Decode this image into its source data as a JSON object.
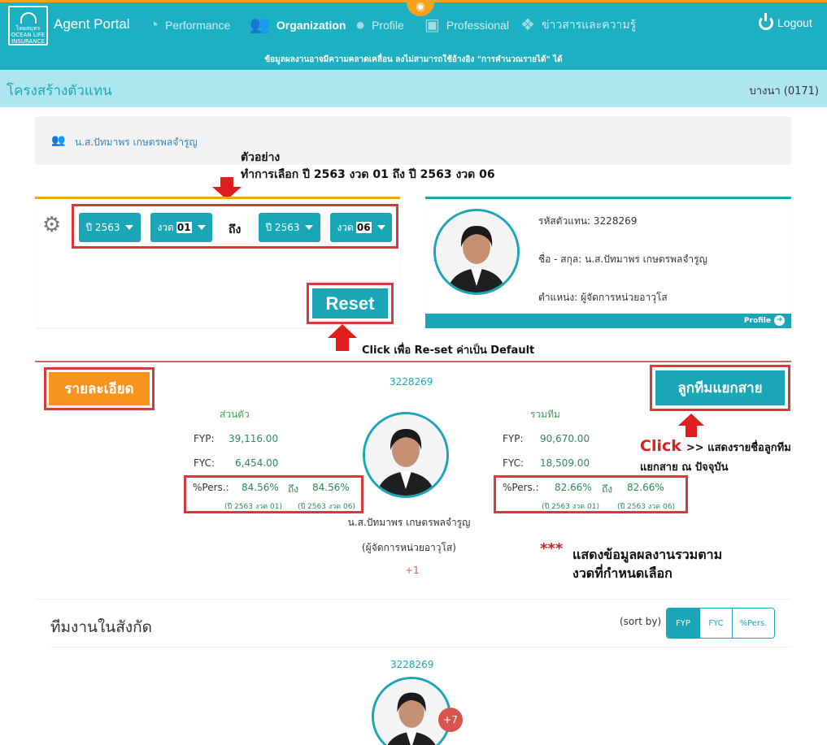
{
  "nav": {
    "logo_text": "ไทยสมุทร OCEAN LIFE INSURANCE",
    "brand": "Agent Portal",
    "items": [
      {
        "label": "Performance",
        "icon": "gauge-icon"
      },
      {
        "label": "Organization",
        "icon": "users-icon"
      },
      {
        "label": "Profile",
        "icon": "user-icon"
      },
      {
        "label": "Professional",
        "icon": "briefcase-icon"
      },
      {
        "label": "ข่าวสารและความรู้",
        "icon": "handshake-icon"
      }
    ],
    "logout": "Logout",
    "notice": "ข้อมูลผลงานอาจมีความคลาดเคลื่อน ลงไม่สามารถใช้อ้างอิง \"การคำนวณรายได้\" ได้"
  },
  "header": {
    "title": "โครงสร้างตัวแทน",
    "branch": "บางนา (0171)"
  },
  "breadcrumb": {
    "text": "น.ส.ปัทมาพร เกษตรพลจำรูญ"
  },
  "annotations": {
    "example_line1": "ตัวอย่าง",
    "example_line2": "ทำการเลือก ปี 2563 งวด 01 ถึง ปี 2563 งวด 06",
    "reset_note": "Click เพื่อ Re-set ค่าเป็น Default",
    "click_word": "Click",
    "team_note_line1": ">> แสดงรายชื่อลูกทีม",
    "team_note_line2": "แยกสาย ณ ปัจจุบัน",
    "stars": "***",
    "summary_line1": "แสดงข้อมูลผลงานรวมตาม",
    "summary_line2": "งวดที่กำหนดเลือก"
  },
  "filter": {
    "from_year": "ปี 2563",
    "from_period_label": "งวด",
    "from_period": "01",
    "to_label": "ถึง",
    "to_year": "ปี 2563",
    "to_period_label": "งวด",
    "to_period": "06",
    "reset": "Reset"
  },
  "profile": {
    "code_line": "รหัสตัวแทน: 3228269",
    "name_line": "ชื่อ - สกุล: น.ส.ปัทมาพร เกษตรพลจำรูญ",
    "position_line": "ตำแหน่ง: ผู้จัดการหน่วยอาวุโส",
    "link": "Profile"
  },
  "summary": {
    "detail_button": "รายละเอียด",
    "team_button": "ลูกทีมแยกสาย",
    "agent_code": "3228269",
    "personal": {
      "heading": "ส่วนตัว",
      "fyp_label": "FYP:",
      "fyp": "39,116.00",
      "fyc_label": "FYC:",
      "fyc": "6,454.00",
      "pers_label": "%Pers.:",
      "pers_from": "84.56%",
      "pers_to_label": "ถึง",
      "pers_to": "84.56%",
      "period_from": "(ปี 2563 งวด 01)",
      "period_to": "(ปี 2563 งวด 06)"
    },
    "team": {
      "heading": "รวมทีม",
      "fyp_label": "FYP:",
      "fyp": "90,670.00",
      "fyc_label": "FYC:",
      "fyc": "18,509.00",
      "pers_label": "%Pers.:",
      "pers_from": "82.66%",
      "pers_to_label": "ถึง",
      "pers_to": "82.66%",
      "period_from": "(ปี 2563 งวด 01)",
      "period_to": "(ปี 2563 งวด 06)"
    },
    "name": "น.ส.ปัทมาพร เกษตรพลจำรูญ",
    "role": "(ผู้จัดการหน่วยอาวุโส)",
    "plus": "+1"
  },
  "team_section": {
    "title": "ทีมงานในสังกัด",
    "sort_label": "(sort by)",
    "sort_options": [
      "FYP",
      "FYC",
      "%Pers."
    ],
    "member_code": "3228269",
    "member_badge": "+7"
  },
  "colors": {
    "primary": "#1cb0c2",
    "accent": "#f7a21b",
    "highlight_red": "#d43b3b",
    "positive_green": "#2e8b57"
  }
}
